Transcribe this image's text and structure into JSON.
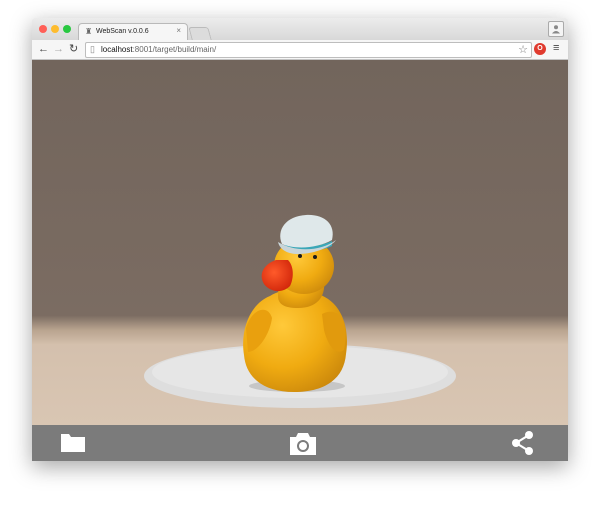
{
  "browser": {
    "tab_title": "WebScan v.0.0.6",
    "tab_close": "×",
    "url_host": "localhost",
    "url_rest": ":8001/target/build/main/",
    "extension_badge": "O"
  },
  "scene": {
    "subject": "3D scanned rubber duck with sailor hat on a turntable",
    "wall_color": "#72655c",
    "floor_color": "#d4c0ad",
    "turntable_color": "#dedede",
    "duck_color": "#f0ab11",
    "beak_color": "#e8320f",
    "hat_color": "#dfe8ea"
  },
  "bottom_toolbar": {
    "buttons": [
      {
        "name": "folder",
        "icon": "folder-icon"
      },
      {
        "name": "camera",
        "icon": "camera-icon"
      },
      {
        "name": "share",
        "icon": "share-icon"
      }
    ],
    "background": "#7b7b7b"
  }
}
